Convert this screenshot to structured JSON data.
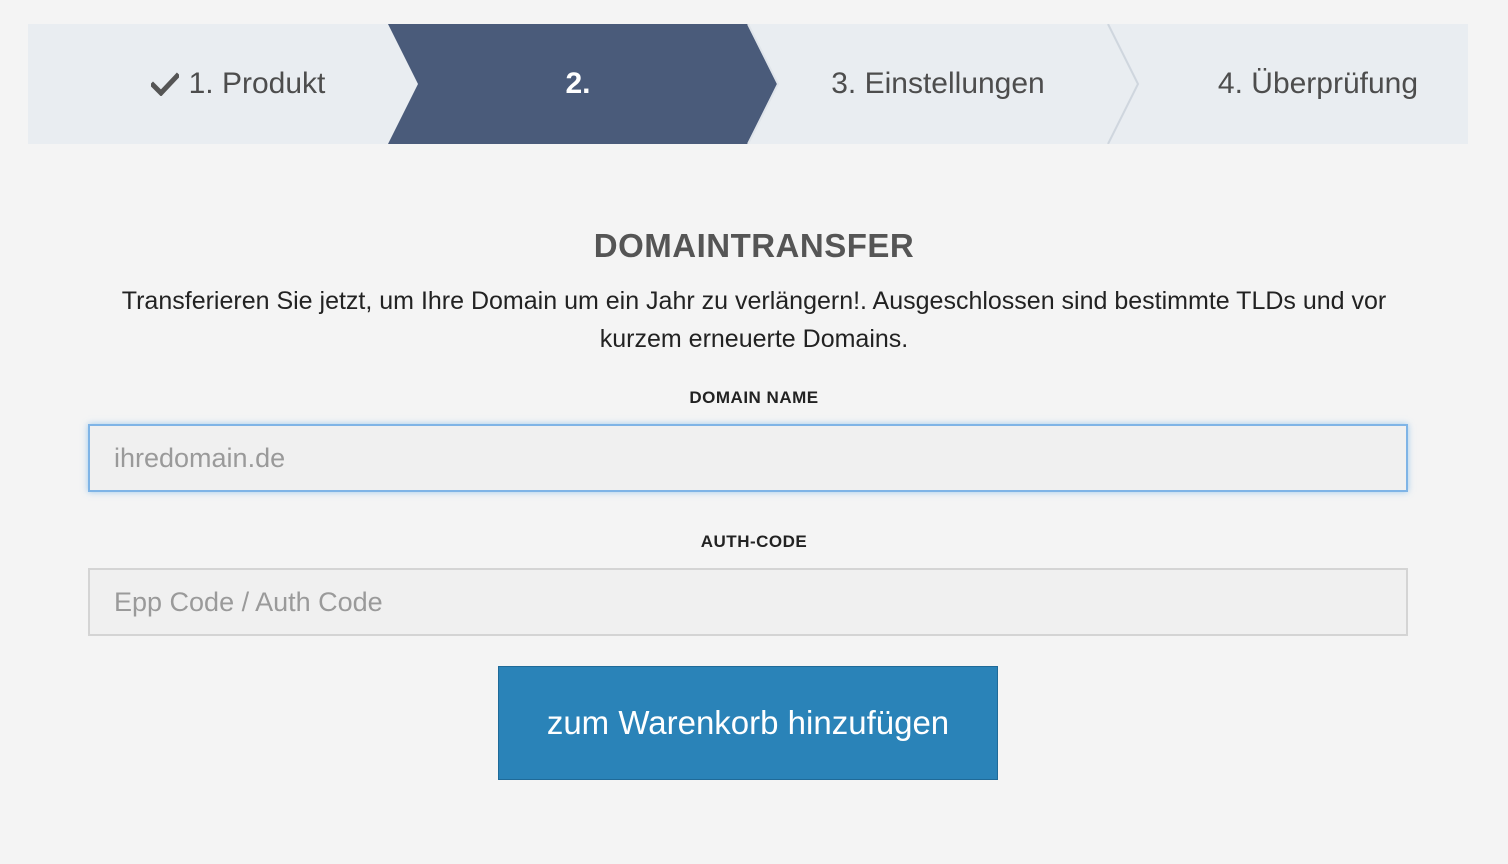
{
  "stepper": {
    "steps": [
      {
        "label": "1. Produkt",
        "state": "completed",
        "icon": "check-icon"
      },
      {
        "label": "2.",
        "state": "active"
      },
      {
        "label": "3. Einstellungen",
        "state": "upcoming"
      },
      {
        "label": "4. Überprüfung",
        "state": "upcoming"
      }
    ],
    "colors": {
      "bg": "#e9edf1",
      "active": "#4a5b7a",
      "separator": "#cfd6de"
    }
  },
  "form": {
    "title": "DOMAINTRANSFER",
    "description": "Transferieren Sie jetzt, um Ihre Domain um ein Jahr zu verlängern!. Ausgeschlossen sind bestimmte TLDs und vor kurzem erneuerte Domains.",
    "domain_label": "DOMAIN NAME",
    "domain_placeholder": "ihredomain.de",
    "domain_value": "",
    "auth_label": "AUTH-CODE",
    "auth_placeholder": "Epp Code / Auth Code",
    "auth_value": "",
    "submit_label": "zum Warenkorb hinzufügen"
  },
  "colors": {
    "button": "#2a83b8",
    "focus_border": "#7fb4e6"
  }
}
